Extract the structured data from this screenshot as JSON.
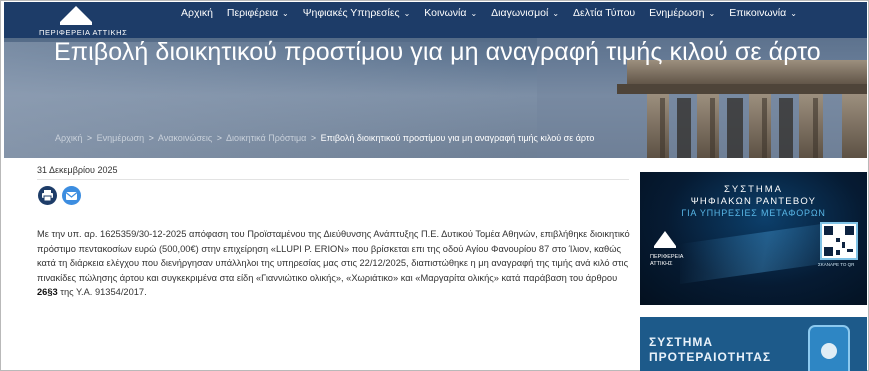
{
  "header": {
    "logo_name": "ΠΕΡΙΦΕΡΕΙΑ ΑΤΤΙΚΗΣ",
    "nav": [
      {
        "label": "Αρχική",
        "has_menu": false
      },
      {
        "label": "Περιφέρεια",
        "has_menu": true
      },
      {
        "label": "Ψηφιακές Υπηρεσίες",
        "has_menu": true
      },
      {
        "label": "Κοινωνία",
        "has_menu": true
      },
      {
        "label": "Διαγωνισμοί",
        "has_menu": true
      },
      {
        "label": "Δελτία Τύπου",
        "has_menu": false
      },
      {
        "label": "Ενημέρωση",
        "has_menu": true
      },
      {
        "label": "Επικοινωνία",
        "has_menu": true
      }
    ],
    "chevron": "⌄"
  },
  "hero": {
    "title": "Επιβολή διοικητικού προστίμου για μη αναγραφή τιμής κιλού σε άρτο"
  },
  "breadcrumb": {
    "items": [
      "Αρχική",
      "Ενημέρωση",
      "Ανακοινώσεις",
      "Διοικητικά Πρόστιμα"
    ],
    "current": "Επιβολή διοικητικού προστίμου για μη αναγραφή τιμής κιλού σε άρτο",
    "separator": ">"
  },
  "article": {
    "date": "31 Δεκεμβρίου 2025",
    "body_before_bold": "Με την υπ. αρ. 1625359/30-12-2025 απόφαση του Προϊσταμένου της Διεύθυνσης Ανάπτυξης Π.Ε. Δυτικού Τομέα Αθηνών, επιβλήθηκε διοικητικό πρόστιμο πεντακοσίων ευρώ (500,00€) στην επιχείρηση «LLUPI P. ERION» που βρίσκεται επι της οδού Αγίου Φανουρίου 87 στο Ίλιον, καθώς κατά τη διάρκεια ελέγχου που διενήργησαν υπάλληλοι της υπηρεσίας μας στις 22/12/2025, διαπιστώθηκε η μη αναγραφή της τιμής ανά κιλό στις πινακίδες πώλησης άρτου και συγκεκριμένα στα είδη «Γιαννιώτικο ολικής», «Χωριάτικο» και «Μαργαρίτα ολικής» κατά παράβαση του άρθρου ",
    "body_bold": "26§3",
    "body_after_bold": " της Υ.Α. 91354/2017."
  },
  "share": {
    "print_icon": "printer-icon",
    "mail_icon": "envelope-icon"
  },
  "sidebar": {
    "ad1": {
      "line1": "ΣΥΣΤΗΜΑ",
      "line2": "ΨΗΦΙΑΚΩΝ ΡΑΝΤΕΒΟΥ",
      "line3": "ΓΙΑ ΥΠΗΡΕΣΙΕΣ ΜΕΤΑΦΟΡΩΝ",
      "org": "ΠΕΡΙΦΕΡΕΙΑ\nΑΤΤΙΚΗΣ",
      "scan": "ΣΚΑΝΑΡΕ ΤΟ QR"
    },
    "ad2": {
      "line1": "ΣΥΣΤΗΜΑ",
      "line2": "ΠΡΟΤΕΡΑΙΟΤΗΤΑΣ"
    }
  },
  "colors": {
    "nav_bg": "#1d3c68",
    "print_button": "#1d3c68",
    "mail_button": "#3c8de0",
    "ad2_bg": "#1d5a8a"
  }
}
